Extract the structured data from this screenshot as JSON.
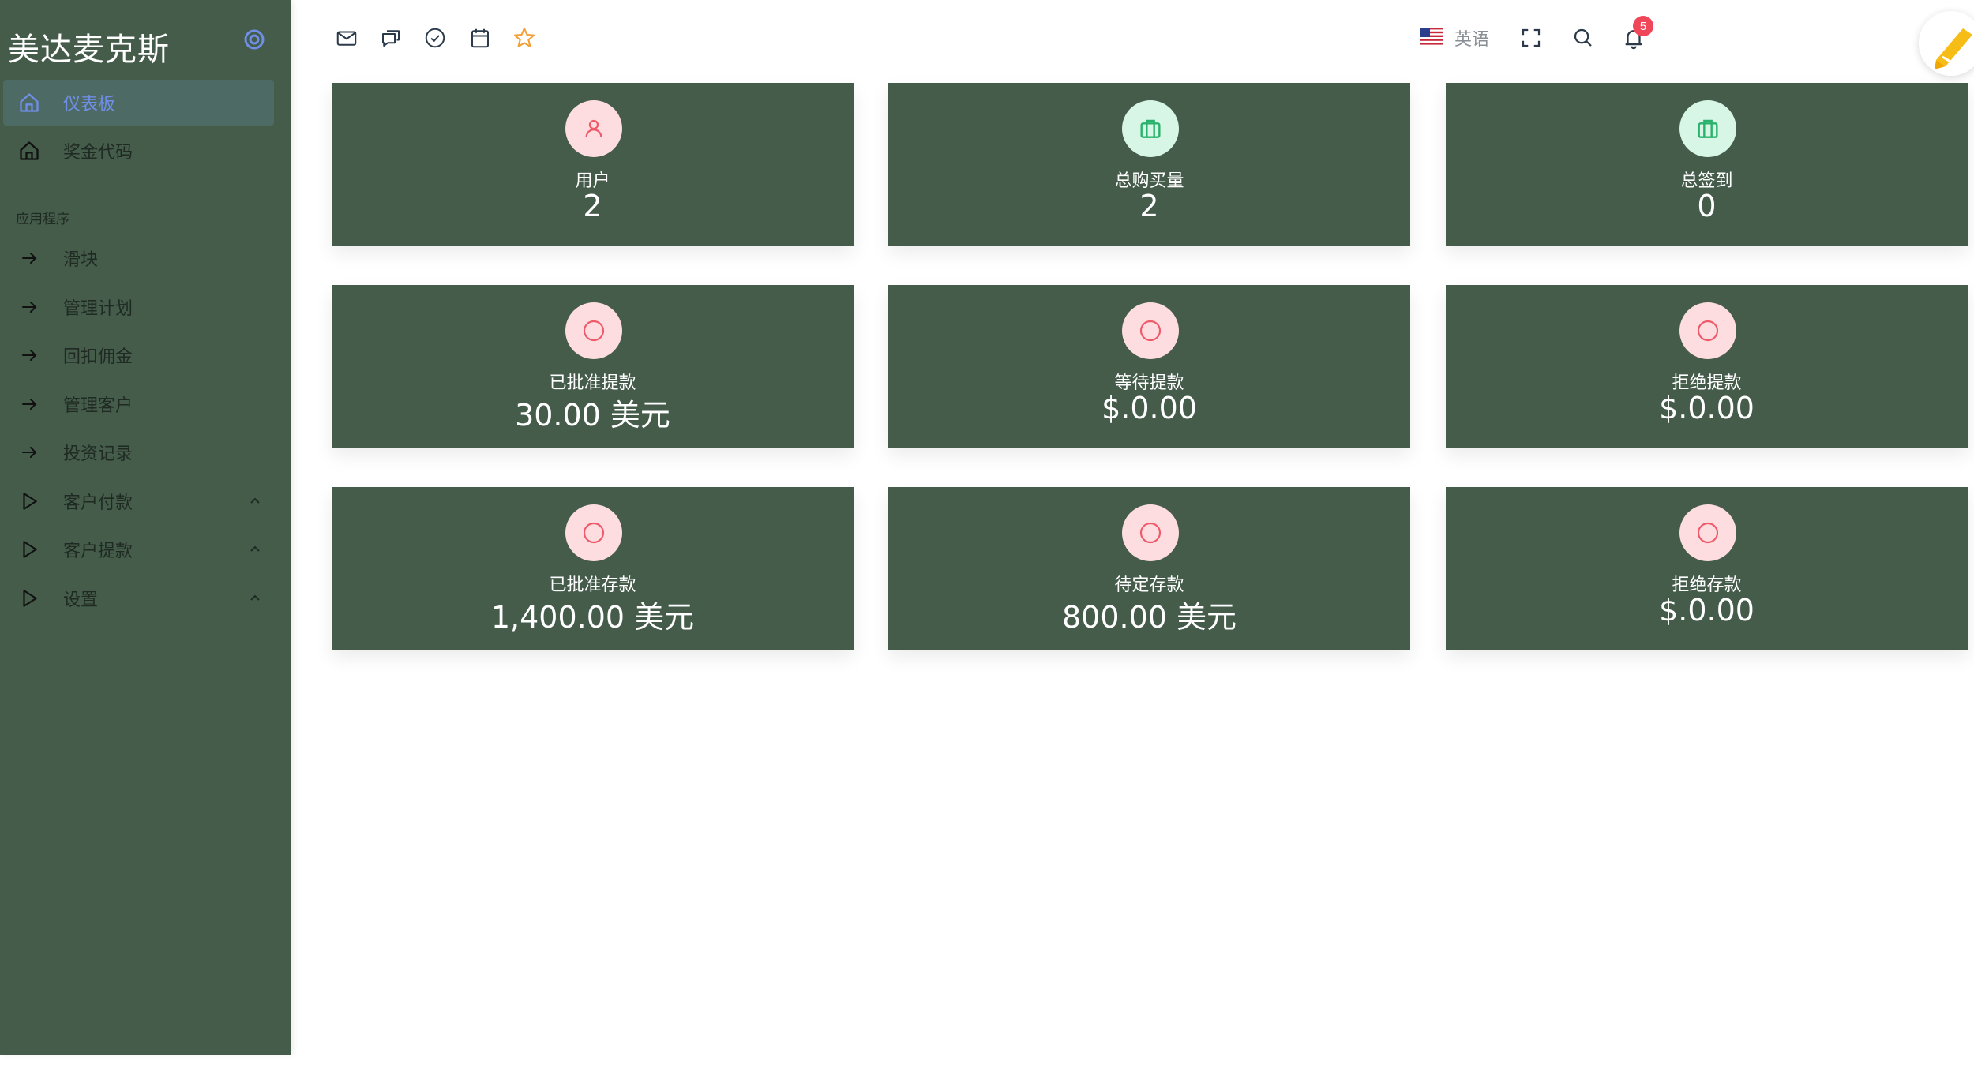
{
  "sidebar": {
    "brand": "美达麦克斯",
    "section_heading": "应用程序",
    "items": [
      {
        "label": "仪表板",
        "icon": "home-icon",
        "active": true
      },
      {
        "label": "奖金代码",
        "icon": "home-icon",
        "active": false
      },
      {
        "label": "滑块",
        "icon": "arrow-right-icon",
        "active": false
      },
      {
        "label": "管理计划",
        "icon": "arrow-right-icon",
        "active": false
      },
      {
        "label": "回扣佣金",
        "icon": "arrow-right-icon",
        "active": false
      },
      {
        "label": "管理客户",
        "icon": "arrow-right-icon",
        "active": false
      },
      {
        "label": "投资记录",
        "icon": "arrow-right-icon",
        "active": false
      },
      {
        "label": "客户付款",
        "icon": "play-icon",
        "active": false
      },
      {
        "label": "客户提款",
        "icon": "play-icon",
        "active": false
      },
      {
        "label": "设置",
        "icon": "play-icon",
        "active": false
      }
    ]
  },
  "topbar": {
    "shortcut_icons": [
      "mail-icon",
      "chat-icon",
      "check-circle-icon",
      "calendar-icon",
      "star-icon"
    ],
    "language_label": "英语",
    "notification_count": "5"
  },
  "cards": [
    {
      "title": "用户",
      "value": "2",
      "icon": "user-icon",
      "icon_bg": "#fddddf"
    },
    {
      "title": "总购买量",
      "value": "2",
      "icon": "briefcase-icon",
      "icon_bg": "#d8f6e6"
    },
    {
      "title": "总签到",
      "value": "0",
      "icon": "briefcase-icon",
      "icon_bg": "#d8f6e6"
    },
    {
      "title": "已批准提款",
      "value": "30.00 美元",
      "icon": "circle-icon",
      "icon_bg": "#fddddf"
    },
    {
      "title": "等待提款",
      "value": "$.0.00",
      "icon": "circle-icon",
      "icon_bg": "#fddddf"
    },
    {
      "title": "拒绝提款",
      "value": "$.0.00",
      "icon": "circle-icon",
      "icon_bg": "#fddddf"
    },
    {
      "title": "已批准存款",
      "value": "1,400.00 美元",
      "icon": "circle-icon",
      "icon_bg": "#fddddf"
    },
    {
      "title": "待定存款",
      "value": "800.00 美元",
      "icon": "circle-icon",
      "icon_bg": "#fddddf"
    },
    {
      "title": "拒绝存款",
      "value": "$.0.00",
      "icon": "circle-icon",
      "icon_bg": "#fddddf"
    }
  ],
  "colors": {
    "sidebar_bg": "#455c4b",
    "card_bg": "#455c4b",
    "active_item": "#6f8fe6",
    "badge": "#f0465a",
    "star": "#f2a23a"
  }
}
